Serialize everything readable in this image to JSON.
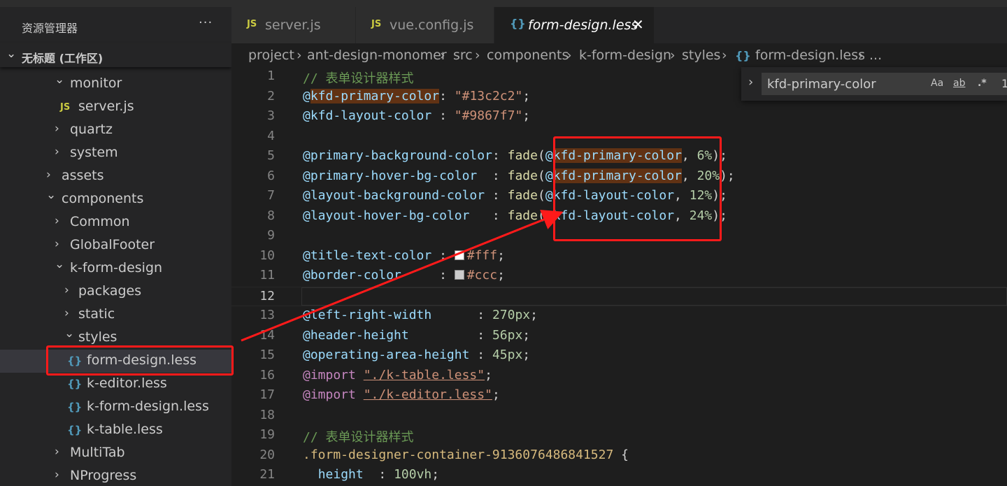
{
  "sidebar": {
    "title": "资源管理器",
    "more_label": "···",
    "workspace": "无标题 (工作区)",
    "tree": [
      {
        "label": "monitor",
        "type": "folder",
        "expanded": true,
        "depth": 1
      },
      {
        "label": "server.js",
        "type": "js",
        "depth": 2
      },
      {
        "label": "quartz",
        "type": "folder",
        "expanded": false,
        "depth": 1
      },
      {
        "label": "system",
        "type": "folder",
        "expanded": false,
        "depth": 1
      },
      {
        "label": "assets",
        "type": "folder",
        "expanded": false,
        "depth": 0
      },
      {
        "label": "components",
        "type": "folder",
        "expanded": true,
        "depth": 0
      },
      {
        "label": "Common",
        "type": "folder",
        "expanded": false,
        "depth": 1
      },
      {
        "label": "GlobalFooter",
        "type": "folder",
        "expanded": false,
        "depth": 1
      },
      {
        "label": "k-form-design",
        "type": "folder",
        "expanded": true,
        "depth": 1
      },
      {
        "label": "packages",
        "type": "folder",
        "expanded": false,
        "depth": 2
      },
      {
        "label": "static",
        "type": "folder",
        "expanded": false,
        "depth": 2
      },
      {
        "label": "styles",
        "type": "folder",
        "expanded": true,
        "depth": 2
      },
      {
        "label": "form-design.less",
        "type": "less",
        "depth": 3,
        "selected": true
      },
      {
        "label": "k-editor.less",
        "type": "less",
        "depth": 3
      },
      {
        "label": "k-form-design.less",
        "type": "less",
        "depth": 3
      },
      {
        "label": "k-table.less",
        "type": "less",
        "depth": 3
      },
      {
        "label": "MultiTab",
        "type": "folder",
        "expanded": false,
        "depth": 1
      },
      {
        "label": "NProgress",
        "type": "folder",
        "expanded": false,
        "depth": 1
      }
    ]
  },
  "tabs": [
    {
      "label": "server.js",
      "icon": "js-icon",
      "active": false
    },
    {
      "label": "vue.config.js",
      "icon": "js-icon",
      "active": false
    },
    {
      "label": "form-design.less",
      "icon": "less-icon",
      "active": true,
      "close": "✕"
    }
  ],
  "icons": {
    "js": "JS",
    "less": "{}"
  },
  "breadcrumb": {
    "items": [
      "project",
      "ant-design-monomer",
      "src",
      "components",
      "k-form-design",
      "styles",
      "form-design.less",
      "..."
    ],
    "separator": "›"
  },
  "find": {
    "value": "kfd-primary-color",
    "match_case": "Aa",
    "whole_word": "ab",
    "regex": ".*",
    "count": "1"
  },
  "editor": {
    "current_line": 12,
    "lines": [
      {
        "n": "1",
        "tokens": [
          {
            "t": "// 表单设计器样式",
            "c": "comment"
          }
        ]
      },
      {
        "n": "2",
        "tokens": [
          {
            "t": "@",
            "c": "var"
          },
          {
            "t": "kfd-primary-color",
            "c": "var",
            "m": true
          },
          {
            "t": ": ",
            "c": "punc"
          },
          {
            "t": "\"#13c2c2\"",
            "c": "str"
          },
          {
            "t": ";",
            "c": "punc"
          }
        ]
      },
      {
        "n": "3",
        "tokens": [
          {
            "t": "@kfd-layout-color",
            "c": "var"
          },
          {
            "t": " : ",
            "c": "punc"
          },
          {
            "t": "\"#9867f7\"",
            "c": "str"
          },
          {
            "t": ";",
            "c": "punc"
          }
        ]
      },
      {
        "n": "4",
        "tokens": []
      },
      {
        "n": "5",
        "tokens": [
          {
            "t": "@primary-background-color",
            "c": "var"
          },
          {
            "t": ": ",
            "c": "punc"
          },
          {
            "t": "fade",
            "c": "fn"
          },
          {
            "t": "(",
            "c": "punc"
          },
          {
            "t": "@",
            "c": "var"
          },
          {
            "t": "kfd-primary-color",
            "c": "var",
            "m": true
          },
          {
            "t": ", ",
            "c": "punc"
          },
          {
            "t": "6%",
            "c": "num"
          },
          {
            "t": ");",
            "c": "punc"
          }
        ]
      },
      {
        "n": "6",
        "tokens": [
          {
            "t": "@primary-hover-bg-color",
            "c": "var"
          },
          {
            "t": "  : ",
            "c": "punc"
          },
          {
            "t": "fade",
            "c": "fn"
          },
          {
            "t": "(",
            "c": "punc"
          },
          {
            "t": "@",
            "c": "var"
          },
          {
            "t": "kfd-primary-color",
            "c": "var",
            "m": true
          },
          {
            "t": ", ",
            "c": "punc"
          },
          {
            "t": "20%",
            "c": "num"
          },
          {
            "t": ");",
            "c": "punc"
          }
        ]
      },
      {
        "n": "7",
        "tokens": [
          {
            "t": "@layout-background-color",
            "c": "var"
          },
          {
            "t": " : ",
            "c": "punc"
          },
          {
            "t": "fade",
            "c": "fn"
          },
          {
            "t": "(",
            "c": "punc"
          },
          {
            "t": "@kfd-layout-color",
            "c": "var"
          },
          {
            "t": ", ",
            "c": "punc"
          },
          {
            "t": "12%",
            "c": "num"
          },
          {
            "t": ");",
            "c": "punc"
          }
        ]
      },
      {
        "n": "8",
        "tokens": [
          {
            "t": "@layout-hover-bg-color",
            "c": "var"
          },
          {
            "t": "   : ",
            "c": "punc"
          },
          {
            "t": "fade",
            "c": "fn"
          },
          {
            "t": "(",
            "c": "punc"
          },
          {
            "t": "@kfd-layout-color",
            "c": "var"
          },
          {
            "t": ", ",
            "c": "punc"
          },
          {
            "t": "24%",
            "c": "num"
          },
          {
            "t": ");",
            "c": "punc"
          }
        ]
      },
      {
        "n": "9",
        "tokens": []
      },
      {
        "n": "10",
        "tokens": [
          {
            "t": "@title-text-color",
            "c": "var"
          },
          {
            "t": " : ",
            "c": "punc"
          },
          {
            "sw": "#ffffff"
          },
          {
            "t": "#fff",
            "c": "str"
          },
          {
            "t": ";",
            "c": "punc"
          }
        ]
      },
      {
        "n": "11",
        "tokens": [
          {
            "t": "@border-color",
            "c": "var"
          },
          {
            "t": "     : ",
            "c": "punc"
          },
          {
            "sw": "#cccccc"
          },
          {
            "t": "#ccc",
            "c": "str"
          },
          {
            "t": ";",
            "c": "punc"
          }
        ]
      },
      {
        "n": "12",
        "tokens": []
      },
      {
        "n": "13",
        "tokens": [
          {
            "t": "@left-right-width",
            "c": "var"
          },
          {
            "t": "      : ",
            "c": "punc"
          },
          {
            "t": "270px",
            "c": "num"
          },
          {
            "t": ";",
            "c": "punc"
          }
        ]
      },
      {
        "n": "14",
        "tokens": [
          {
            "t": "@header-height",
            "c": "var"
          },
          {
            "t": "         : ",
            "c": "punc"
          },
          {
            "t": "56px",
            "c": "num"
          },
          {
            "t": ";",
            "c": "punc"
          }
        ]
      },
      {
        "n": "15",
        "tokens": [
          {
            "t": "@operating-area-height",
            "c": "var"
          },
          {
            "t": " : ",
            "c": "punc"
          },
          {
            "t": "45px",
            "c": "num"
          },
          {
            "t": ";",
            "c": "punc"
          }
        ]
      },
      {
        "n": "16",
        "tokens": [
          {
            "t": "@import",
            "c": "kw"
          },
          {
            "t": " ",
            "c": "punc"
          },
          {
            "t": "\"./k-table.less\"",
            "c": "link"
          },
          {
            "t": ";",
            "c": "punc"
          }
        ]
      },
      {
        "n": "17",
        "tokens": [
          {
            "t": "@import",
            "c": "kw"
          },
          {
            "t": " ",
            "c": "punc"
          },
          {
            "t": "\"./k-editor.less\"",
            "c": "link"
          },
          {
            "t": ";",
            "c": "punc"
          }
        ]
      },
      {
        "n": "18",
        "tokens": []
      },
      {
        "n": "19",
        "tokens": [
          {
            "t": "// 表单设计器样式",
            "c": "comment"
          }
        ]
      },
      {
        "n": "20",
        "tokens": [
          {
            "t": ".form-designer-container-9136076486841527",
            "c": "sel"
          },
          {
            "t": " {",
            "c": "punc"
          }
        ]
      },
      {
        "n": "21",
        "tokens": [
          {
            "t": "  ",
            "c": "punc"
          },
          {
            "t": "height",
            "c": "prop"
          },
          {
            "t": "  : ",
            "c": "punc"
          },
          {
            "t": "100vh",
            "c": "num"
          },
          {
            "t": ";",
            "c": "punc"
          }
        ]
      }
    ]
  },
  "colors": {
    "accent_annotation": "#ff1a1a",
    "find_match": "#613214",
    "editor_bg": "#1e1e1e",
    "sidebar_bg": "#252526"
  }
}
